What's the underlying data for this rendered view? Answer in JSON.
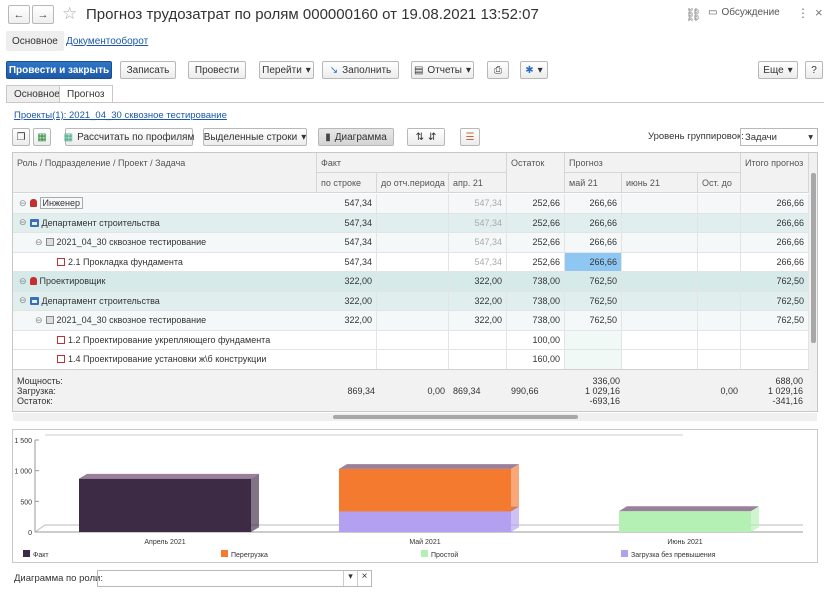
{
  "window": {
    "title": "Прогноз трудозатрат по ролям 000000160 от 19.08.2021 13:52:07",
    "discussion": "Обсуждение"
  },
  "page_tabs": [
    {
      "label": "Основное"
    },
    {
      "label": "Документооборот"
    }
  ],
  "toolbar": {
    "post_close": "Провести и закрыть",
    "save": "Записать",
    "post": "Провести",
    "goto": "Перейти",
    "fill": "Заполнить",
    "reports": "Отчеты",
    "more": "Еще",
    "help": "?"
  },
  "form_tabs": [
    {
      "label": "Основное"
    },
    {
      "label": "Прогноз"
    }
  ],
  "project_link": "Проекты(1): 2021_04_30 сквозное тестирование",
  "subtoolbar": {
    "calc": "Рассчитать по профилям",
    "selected_rows": "Выделенные строки",
    "diagram": "Диаграмма",
    "grouping_label": "Уровень группировок:",
    "grouping_value": "Задачи"
  },
  "table": {
    "h_role": "Роль / Подразделение / Проект / Задача",
    "h_fact": "Факт",
    "h_by_line": "по строке",
    "h_to_period": "до отч.периода",
    "h_apr": "апр. 21",
    "h_rest": "Остаток",
    "h_forecast": "Прогноз",
    "h_may": "май 21",
    "h_jun": "июнь 21",
    "h_ost": "Ост. до",
    "h_total": "Итого прогноз",
    "rows": [
      {
        "name": "Инженер",
        "by_line": "547,34",
        "to_period": "",
        "apr": "547,34",
        "rest": "252,66",
        "may": "266,66",
        "jun": "",
        "ost": "",
        "total": "266,66"
      },
      {
        "name": "Департамент строительства",
        "by_line": "547,34",
        "to_period": "",
        "apr": "547,34",
        "rest": "252,66",
        "may": "266,66",
        "jun": "",
        "ost": "",
        "total": "266,66"
      },
      {
        "name": "2021_04_30 сквозное тестирование",
        "by_line": "547,34",
        "to_period": "",
        "apr": "547,34",
        "rest": "252,66",
        "may": "266,66",
        "jun": "",
        "ost": "",
        "total": "266,66"
      },
      {
        "name": "2.1 Прокладка фундамента",
        "by_line": "547,34",
        "to_period": "",
        "apr": "547,34",
        "rest": "252,66",
        "may": "266,66",
        "jun": "",
        "ost": "",
        "total": "266,66"
      },
      {
        "name": "Проектировщик",
        "by_line": "322,00",
        "to_period": "",
        "apr": "322,00",
        "rest": "738,00",
        "may": "762,50",
        "jun": "",
        "ost": "",
        "total": "762,50"
      },
      {
        "name": "Департамент строительства",
        "by_line": "322,00",
        "to_period": "",
        "apr": "322,00",
        "rest": "738,00",
        "may": "762,50",
        "jun": "",
        "ost": "",
        "total": "762,50"
      },
      {
        "name": "2021_04_30 сквозное тестирование",
        "by_line": "322,00",
        "to_period": "",
        "apr": "322,00",
        "rest": "738,00",
        "may": "762,50",
        "jun": "",
        "ost": "",
        "total": "762,50"
      },
      {
        "name": "1.2 Проектирование укрепляющего фундамента",
        "by_line": "",
        "to_period": "",
        "apr": "",
        "rest": "100,00",
        "may": "",
        "jun": "",
        "ost": "",
        "total": ""
      },
      {
        "name": "1.4 Проектирование установки ж\\б конструкции",
        "by_line": "",
        "to_period": "",
        "apr": "",
        "rest": "160,00",
        "may": "",
        "jun": "",
        "ost": "",
        "total": ""
      }
    ],
    "footer": {
      "labels": [
        "Мощность:",
        "Загрузка:",
        "Остаток:"
      ],
      "by_line": "869,34",
      "to_period": "0,00",
      "apr": "869,34",
      "rest": "990,66",
      "may": [
        "336,00",
        "1 029,16",
        "-693,16"
      ],
      "ost": "0,00",
      "total": [
        "688,00",
        "1 029,16",
        "-341,16"
      ]
    }
  },
  "chart_data": {
    "type": "bar",
    "categories": [
      "Апрель 2021",
      "Май 2021",
      "Июнь 2021"
    ],
    "series": [
      {
        "name": "Факт",
        "values": [
          869.34,
          0,
          0
        ],
        "color": "#3d2a45"
      },
      {
        "name": "Перегрузка",
        "values": [
          0,
          693.16,
          0
        ],
        "color": "#f47a30"
      },
      {
        "name": "Простой",
        "values": [
          0,
          0,
          341.16
        ],
        "color": "#b4f0b4"
      },
      {
        "name": "Загрузка без превышения",
        "values": [
          0,
          336,
          0
        ],
        "color": "#b4a0f0"
      }
    ],
    "ylim": [
      0,
      1500
    ],
    "yticks": [
      "1 500",
      "1 000",
      "500",
      "0"
    ],
    "legend": "bottom"
  },
  "bottom": {
    "label": "Диаграмма по роли:",
    "value": ""
  }
}
